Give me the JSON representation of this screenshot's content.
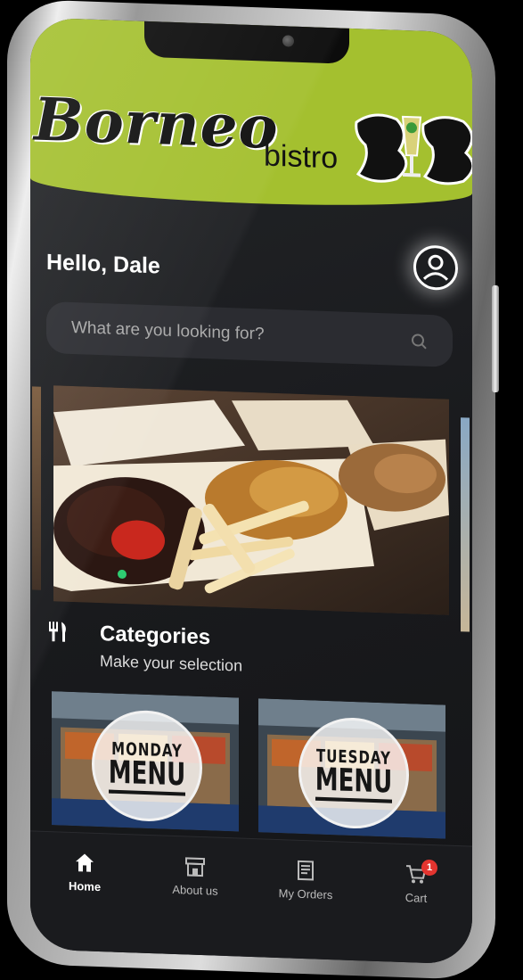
{
  "header": {
    "brand": "Borneo",
    "brand_sub": "bistro",
    "brand_color": "#a4c02f"
  },
  "greeting": "Hello, Dale",
  "search": {
    "placeholder": "What are you looking for?"
  },
  "carousel": {
    "active_index": 0,
    "count": 3,
    "indicator_color": "#2ecc71"
  },
  "categories": {
    "title": "Categories",
    "subtitle": "Make your selection",
    "icon": "utensils-icon",
    "cards": [
      {
        "line1": "MONDAY",
        "line2": "MENU"
      },
      {
        "line1": "TUESDAY",
        "line2": "MENU"
      }
    ]
  },
  "nav": {
    "items": [
      {
        "label": "Home",
        "icon": "home-icon",
        "active": true
      },
      {
        "label": "About us",
        "icon": "store-icon",
        "active": false
      },
      {
        "label": "My Orders",
        "icon": "orders-icon",
        "active": false
      },
      {
        "label": "Cart",
        "icon": "cart-icon",
        "active": false,
        "badge": "1"
      }
    ]
  }
}
